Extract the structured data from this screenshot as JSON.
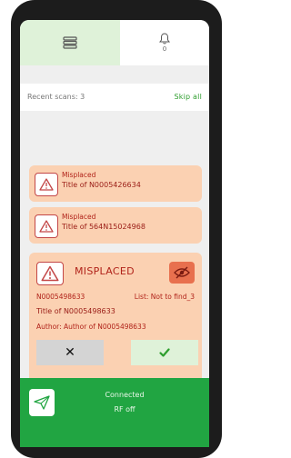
{
  "header": {
    "notification_count": "0"
  },
  "scans": {
    "recent_label": "Recent scans: 3",
    "skip_label": "Skip all"
  },
  "cards": [
    {
      "status": "Misplaced",
      "title": "Title of N0005426634"
    },
    {
      "status": "Misplaced",
      "title": "Title of 564N15024968"
    }
  ],
  "detail": {
    "status": "MISPLACED",
    "id": "N0005498633",
    "list": "List: Not to find_3",
    "title": "Title of N0005498633",
    "author": "Author: Author of N0005498633",
    "reject_label": "✕"
  },
  "footer": {
    "connected": "Connected",
    "rf": "RF off"
  },
  "colors": {
    "accent_green": "#21a542",
    "card_bg": "#fbd1b2",
    "warn_red": "#b1231a"
  }
}
